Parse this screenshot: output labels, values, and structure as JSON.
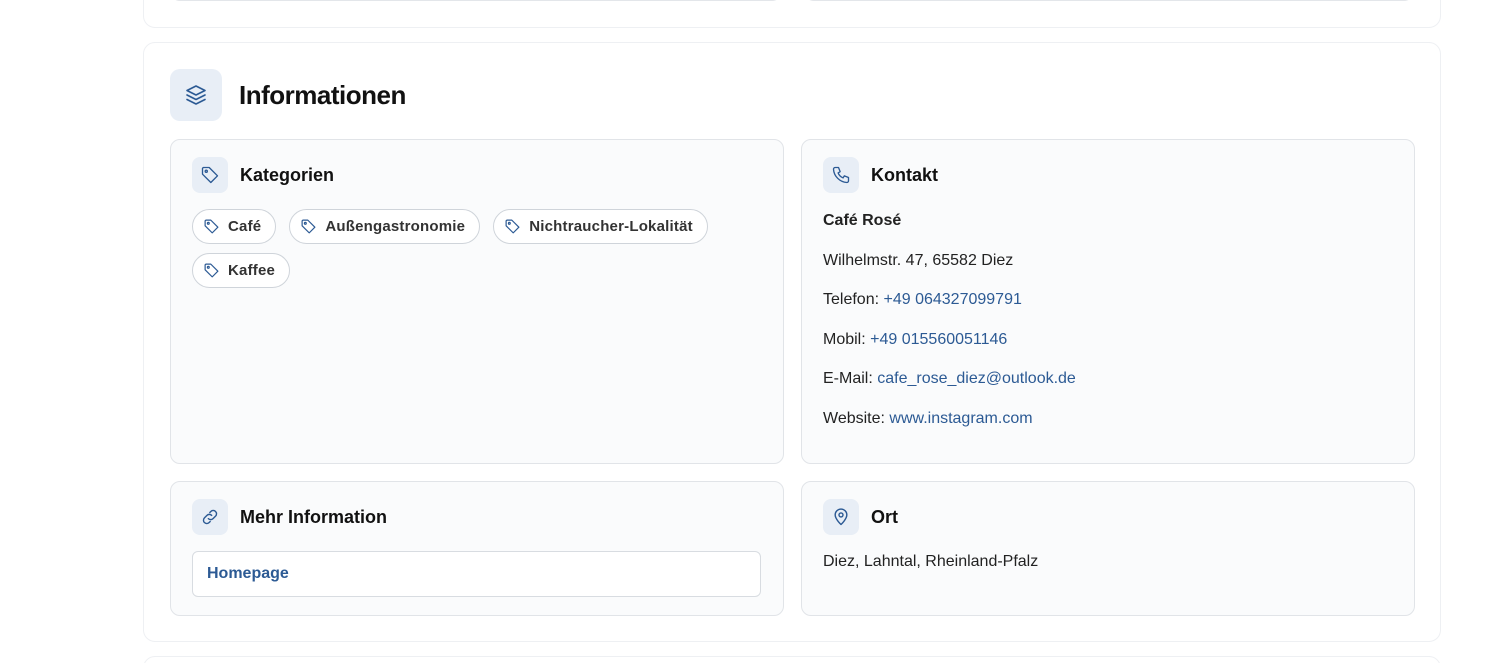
{
  "section": {
    "title": "Informationen"
  },
  "kategorien": {
    "title": "Kategorien",
    "tags": [
      "Café",
      "Außengastronomie",
      "Nichtraucher-Lokalität",
      "Kaffee"
    ]
  },
  "kontakt": {
    "title": "Kontakt",
    "name": "Café Rosé",
    "address": "Wilhelmstr. 47, 65582 Diez",
    "phone_label": "Telefon:",
    "phone": "+49 064327099791",
    "mobile_label": "Mobil:",
    "mobile": "+49 015560051146",
    "email_label": "E-Mail:",
    "email": "cafe_rose_diez@outlook.de",
    "website_label": "Website:",
    "website": "www.instagram.com"
  },
  "mehr": {
    "title": "Mehr Information",
    "homepage_label": "Homepage"
  },
  "ort": {
    "title": "Ort",
    "location": "Diez, Lahntal, Rheinland-Pfalz"
  },
  "colors": {
    "accent": "#2c5a94",
    "icon_bg": "#e8eef6",
    "panel_bg": "#fafbfc",
    "border": "#e1e4e8"
  },
  "icons": {
    "section": "layers-icon",
    "kategorien": "tag-icon",
    "kontakt": "phone-icon",
    "mehr": "link-icon",
    "ort": "map-pin-icon"
  }
}
